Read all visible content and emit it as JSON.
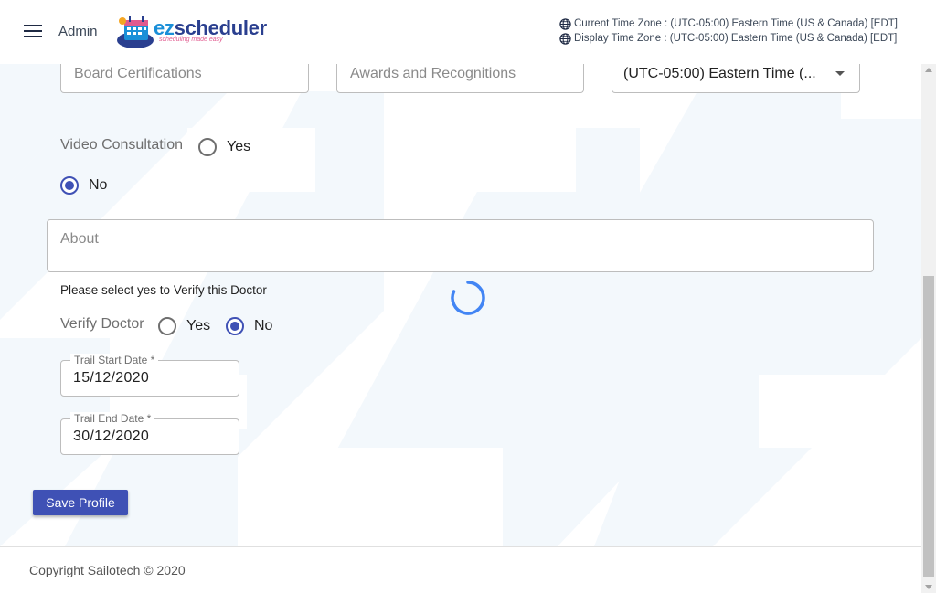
{
  "header": {
    "admin_label": "Admin",
    "logo_text_ez": "ez",
    "logo_text_rest": "scheduler",
    "logo_tagline": "scheduling made easy",
    "current_timezone": "Current Time Zone : (UTC-05:00) Eastern Time (US & Canada) [EDT]",
    "display_timezone": "Display Time Zone : (UTC-05:00) Eastern Time (US & Canada) [EDT]"
  },
  "form": {
    "board_certifications_placeholder": "Board Certifications",
    "awards_placeholder": "Awards and Recognitions",
    "timezone_select_value": "(UTC-05:00) Eastern Time (...",
    "video_consultation_label": "Video Consultation",
    "video_yes_label": "Yes",
    "video_no_label": "No",
    "video_selected": "No",
    "about_placeholder": "About",
    "verify_helper": "Please select yes to Verify this Doctor",
    "verify_label": "Verify Doctor",
    "verify_yes_label": "Yes",
    "verify_no_label": "No",
    "verify_selected": "No",
    "trail_start_label": "Trail Start Date *",
    "trail_start_value": "15/12/2020",
    "trail_end_label": "Trail End Date *",
    "trail_end_value": "30/12/2020",
    "save_button": "Save Profile"
  },
  "footer": {
    "copyright": "Copyright Sailotech © 2020"
  },
  "colors": {
    "primary": "#3f51b5",
    "spinner": "#4285f4"
  }
}
